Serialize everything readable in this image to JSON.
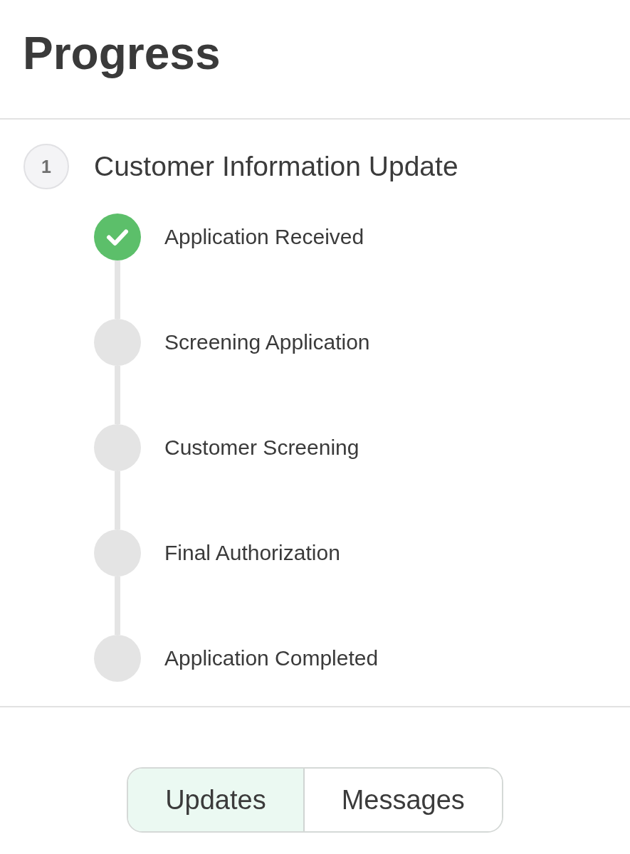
{
  "header": {
    "title": "Progress"
  },
  "section": {
    "number": "1",
    "title": "Customer Information Update"
  },
  "steps": [
    {
      "label": "Application Received",
      "completed": true
    },
    {
      "label": "Screening Application",
      "completed": false
    },
    {
      "label": "Customer Screening",
      "completed": false
    },
    {
      "label": "Final Authorization",
      "completed": false
    },
    {
      "label": "Application Completed",
      "completed": false
    }
  ],
  "tabs": [
    {
      "label": "Updates",
      "selected": true
    },
    {
      "label": "Messages",
      "selected": false
    }
  ]
}
